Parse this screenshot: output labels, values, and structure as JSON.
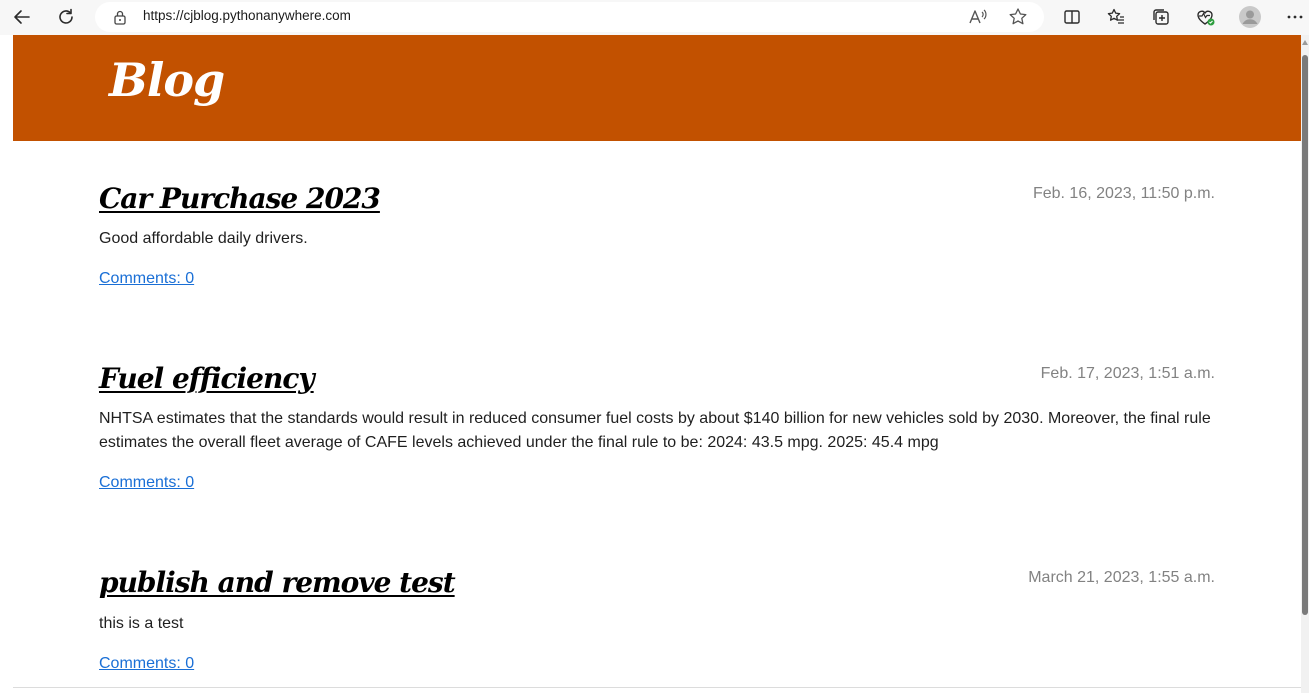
{
  "browser": {
    "url": "https://cjblog.pythonanywhere.com"
  },
  "site": {
    "brand": "Blog",
    "header_color": "#c25100"
  },
  "posts": [
    {
      "title": "Car Purchase 2023",
      "date": "Feb. 16, 2023, 11:50 p.m.",
      "body": "Good affordable daily drivers.",
      "comments": "Comments: 0"
    },
    {
      "title": "Fuel efficiency",
      "date": "Feb. 17, 2023, 1:51 a.m.",
      "body": "NHTSA estimates that the standards would result in reduced consumer fuel costs by about $140 billion for new vehicles sold by 2030. Moreover, the final rule estimates the overall fleet average of CAFE levels achieved under the final rule to be: 2024: 43.5 mpg. 2025: 45.4 mpg",
      "comments": "Comments: 0"
    },
    {
      "title": "publish and remove test",
      "date": "March 21, 2023, 1:55 a.m.",
      "body": "this is a test",
      "comments": "Comments: 0"
    }
  ]
}
